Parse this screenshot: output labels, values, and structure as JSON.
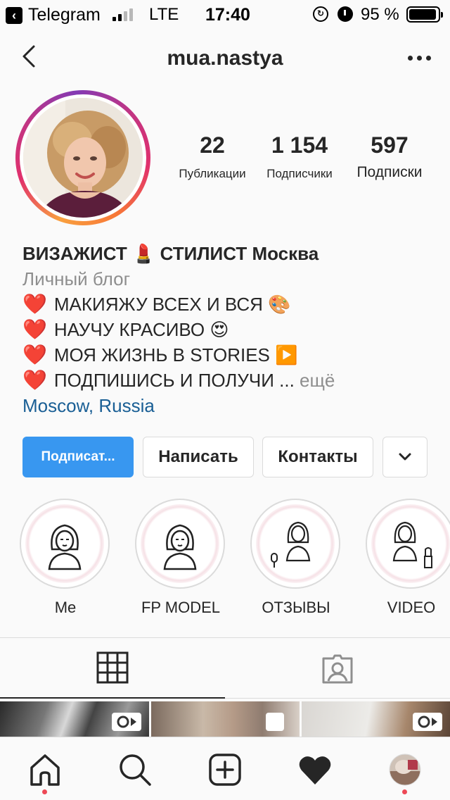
{
  "status_bar": {
    "back_app": "Telegram",
    "network": "LTE",
    "time": "17:40",
    "battery_percent": "95 %",
    "battery_level": 0.95,
    "signal_bars": 4,
    "signal_bars_on": 2
  },
  "nav": {
    "back_icon": "chevron-left-icon",
    "username": "mua.nastya",
    "more_icon": "ellipsis-icon"
  },
  "profile": {
    "stats": {
      "posts_count": "22",
      "posts_label": "Публикации",
      "followers_count": "1 154",
      "followers_label": "Подписчики",
      "following_count": "597",
      "following_label": "Подписки"
    },
    "name_part1": "ВИЗАЖИСТ",
    "name_emoji": "💄",
    "name_part2": "СТИЛИСТ Москва",
    "category": "Личный блог",
    "bio_lines": [
      {
        "heart": "❤️",
        "text": "МАКИЯЖУ ВСЕХ И ВСЯ",
        "emoji": "🎨"
      },
      {
        "heart": "❤️",
        "text": "НАУЧУ КРАСИВО",
        "emoji": "😍"
      },
      {
        "heart": "❤️",
        "text": "МОЯ ЖИЗНЬ В STORIES",
        "emoji": "▶️"
      },
      {
        "heart": "❤️",
        "text": "ПОДПИШИСЬ И ПОЛУЧИ ...",
        "emoji": ""
      }
    ],
    "more_label": "ещё",
    "location": "Moscow, Russia"
  },
  "actions": {
    "follow_label": "Подписат...",
    "message_label": "Написать",
    "contacts_label": "Контакты",
    "expand_icon": "chevron-down-icon"
  },
  "highlights": [
    {
      "label": "Me",
      "icon": "woman-icon"
    },
    {
      "label": "FP MODEL",
      "icon": "woman-icon"
    },
    {
      "label": "ОТЗЫВЫ",
      "icon": "woman-with-microphone-icon"
    },
    {
      "label": "VIDEO",
      "icon": "woman-with-lipstick-icon"
    }
  ],
  "content_tabs": [
    {
      "name": "grid",
      "icon": "grid-icon",
      "active": true
    },
    {
      "name": "tagged",
      "icon": "tagged-person-icon",
      "active": false
    }
  ],
  "thumbnails": [
    {
      "badge_icon": "igtv-icon"
    },
    {
      "badge_icon": "carousel-icon"
    },
    {
      "badge_icon": "igtv-icon"
    }
  ],
  "tabbar": [
    {
      "name": "home",
      "icon": "home-icon",
      "dot": true
    },
    {
      "name": "search",
      "icon": "search-icon",
      "dot": false
    },
    {
      "name": "new-post",
      "icon": "plus-square-icon",
      "dot": false
    },
    {
      "name": "activity",
      "icon": "heart-icon",
      "dot": false
    },
    {
      "name": "profile",
      "icon": "avatar-icon",
      "dot": true
    }
  ],
  "colors": {
    "primary_blue": "#3897f0",
    "link_blue": "#1a5f95",
    "muted_gray": "#8e8e8e",
    "text": "#262626",
    "notification_red": "#ed4956"
  }
}
